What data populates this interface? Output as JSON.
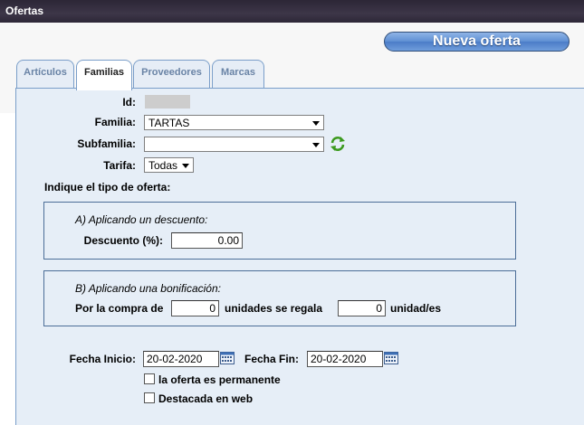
{
  "window": {
    "title": "Ofertas"
  },
  "actions": {
    "new_offer_label": "Nueva oferta"
  },
  "tabs": [
    {
      "label": "Artículos",
      "active": false
    },
    {
      "label": "Familias",
      "active": true
    },
    {
      "label": "Proveedores",
      "active": false
    },
    {
      "label": "Marcas",
      "active": false
    }
  ],
  "form": {
    "id_label": "Id:",
    "id_value": "",
    "familia_label": "Familia:",
    "familia_value": "TARTAS",
    "subfamilia_label": "Subfamilia:",
    "subfamilia_value": "",
    "tarifa_label": "Tarifa:",
    "tarifa_value": "Todas",
    "offer_type_label": "Indique el tipo de oferta:"
  },
  "discount_box": {
    "title": "A) Aplicando un descuento:",
    "discount_label": "Descuento (%):",
    "discount_value": "0.00"
  },
  "bonus_box": {
    "title": "B) Aplicando una bonificación:",
    "purchase_label": "Por la compra de",
    "purchase_value": "0",
    "gift_label": "unidades se regala",
    "gift_value": "0",
    "unit_label": "unidad/es"
  },
  "dates": {
    "start_label": "Fecha Inicio:",
    "start_value": "20-02-2020",
    "end_label": "Fecha Fin:",
    "end_value": "20-02-2020"
  },
  "options": {
    "permanent_label": "la oferta es permanente",
    "permanent_checked": false,
    "featured_label": "Destacada en web",
    "featured_checked": false
  },
  "icons": {
    "refresh": "refresh-icon",
    "calendar": "calendar-icon",
    "dropdown": "chevron-down-icon"
  },
  "colors": {
    "titlebar": "#2c2636",
    "panel": "#e6eef7",
    "accent": "#5f8fd3",
    "border": "#4c6e98"
  }
}
